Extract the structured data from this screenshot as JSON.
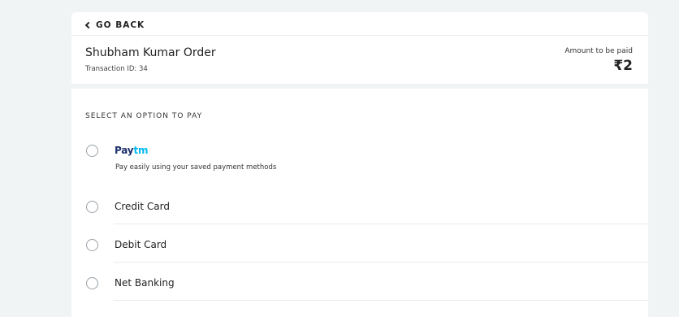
{
  "header": {
    "back_label": "GO BACK",
    "order_title": "Shubham Kumar Order",
    "transaction_id": "Transaction ID: 34",
    "amount_label": "Amount to be paid",
    "amount": "₹2"
  },
  "payment": {
    "section_title": "SELECT AN OPTION TO PAY",
    "paytm": {
      "logo_part1": "Pay",
      "logo_part2": "tm",
      "description": "Pay easily using your saved payment methods"
    },
    "options": [
      {
        "label": "Credit Card"
      },
      {
        "label": "Debit Card"
      },
      {
        "label": "Net Banking"
      }
    ]
  },
  "colors": {
    "background": "#f1f4f5",
    "paytm_dark": "#1d2f6b",
    "paytm_light": "#00b9f1"
  }
}
